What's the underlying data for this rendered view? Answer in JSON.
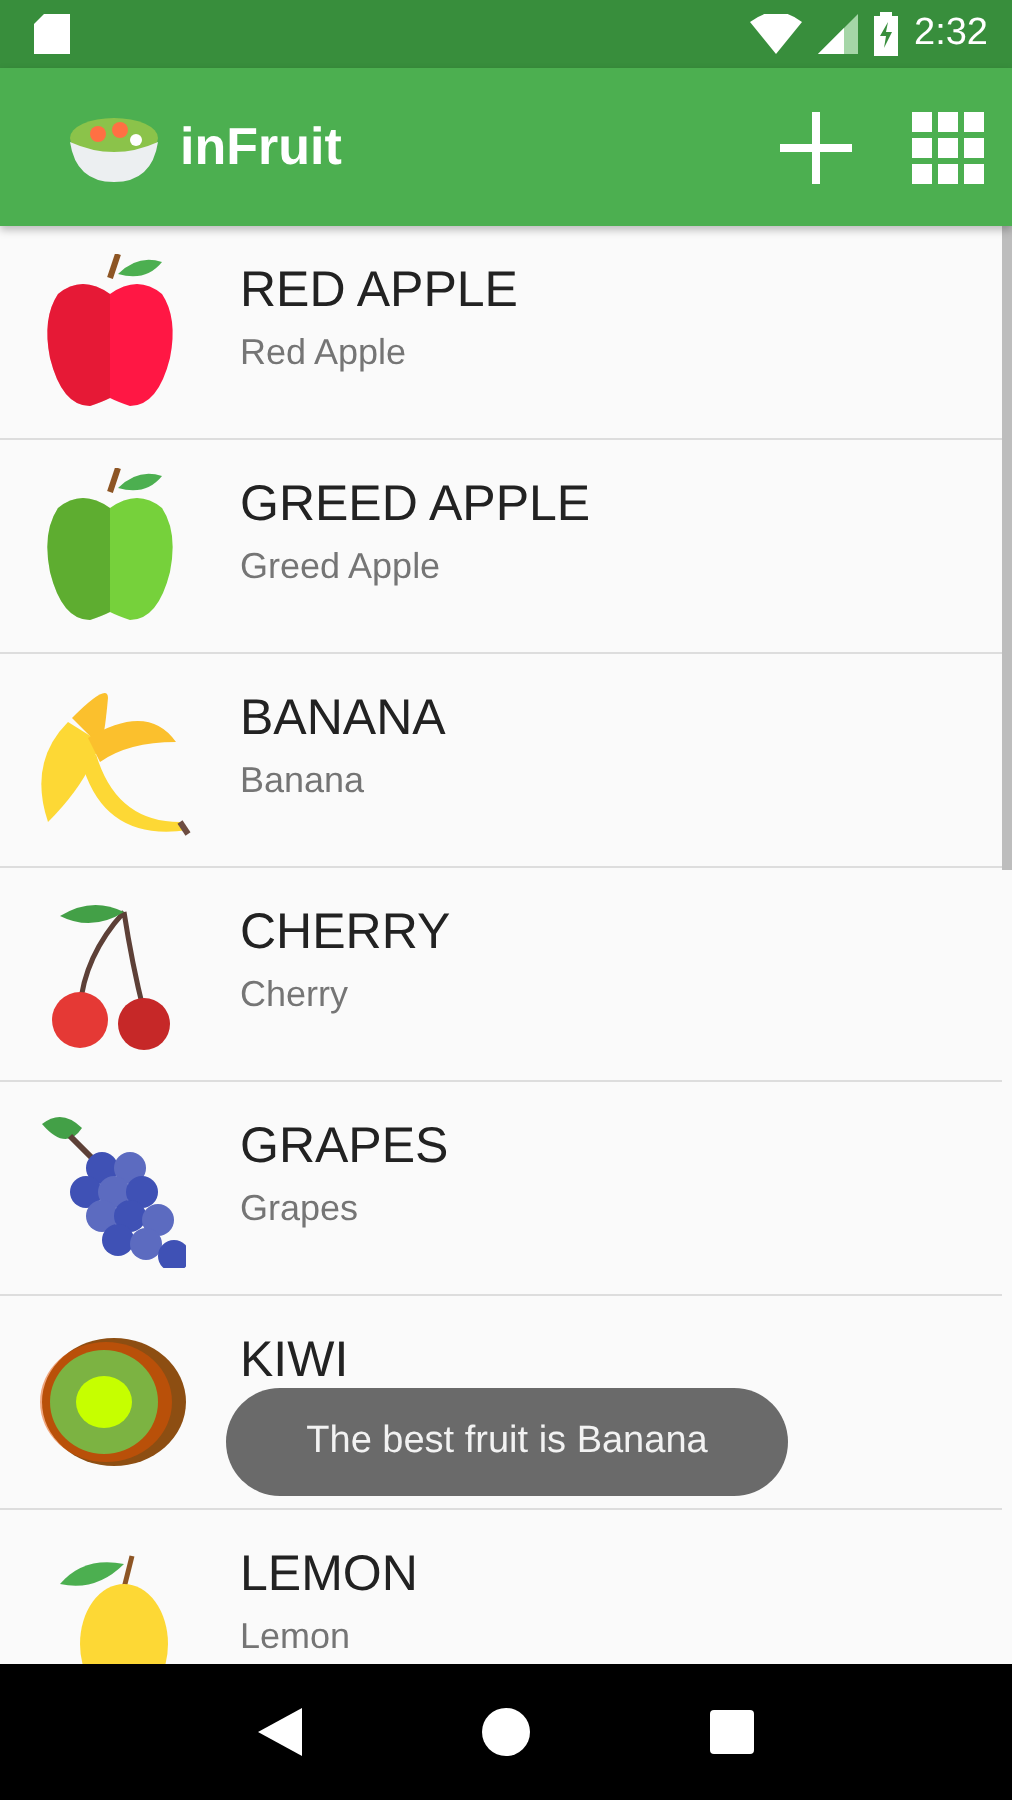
{
  "status_bar": {
    "time": "2:32"
  },
  "toolbar": {
    "title": "inFruit"
  },
  "fruits": [
    {
      "title": "RED APPLE",
      "subtitle": "Red Apple"
    },
    {
      "title": "GREED APPLE",
      "subtitle": "Greed Apple"
    },
    {
      "title": "BANANA",
      "subtitle": "Banana"
    },
    {
      "title": "CHERRY",
      "subtitle": "Cherry"
    },
    {
      "title": "GRAPES",
      "subtitle": "Grapes"
    },
    {
      "title": "KIWI"
    },
    {
      "title": "LEMON",
      "subtitle": "Lemon"
    }
  ],
  "toast": {
    "message": "The best fruit is Banana"
  }
}
